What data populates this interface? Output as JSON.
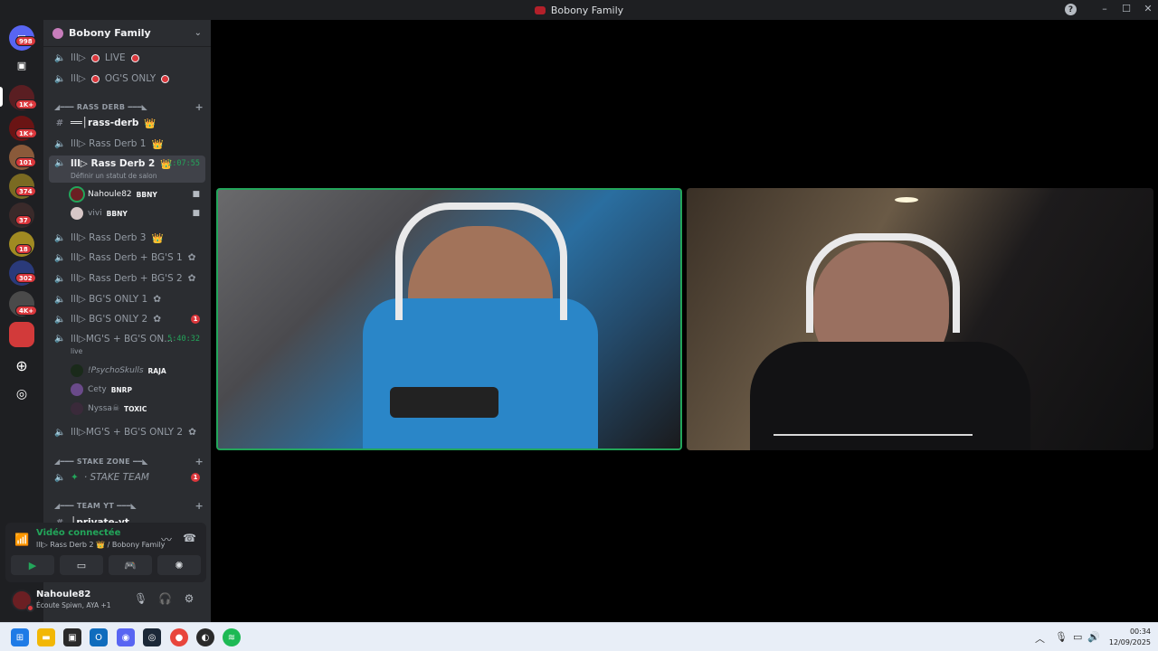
{
  "window": {
    "title": "Bobony Family",
    "help_icon": "?",
    "min": "–",
    "max": "☐",
    "close": "✕"
  },
  "rail": {
    "badges": [
      "998",
      "1K+",
      "1K+",
      "101",
      "374",
      "37",
      "18",
      "302",
      "4K+"
    ]
  },
  "server": {
    "name": "Bobony Family"
  },
  "channels": [
    {
      "label": "lll▷",
      "suffix": "LIVE"
    },
    {
      "label": "lll▷",
      "suffix": "OG'S ONLY"
    }
  ],
  "categories": {
    "rass_derb": "◢━━━ RASS DERB ━━━◣",
    "stake_zone": "◢━━━ STAKE ZONE ━━◣",
    "team_yt": "◢━━━ TEAM YT ━━━◣"
  },
  "rass_channels": {
    "text": "══│rass-derb",
    "derb1": "lll▷ Rass Derb 1",
    "derb2": "lll▷ Rass Derb 2",
    "derb2_timer": "1:07:55",
    "derb2_sub": "Définir un statut de salon",
    "derb3": "lll▷ Rass Derb 3",
    "bg1": "lll▷ Rass Derb + BG'S 1",
    "bg2": "lll▷ Rass Derb + BG'S 2",
    "bgonly1": "lll▷ BG'S ONLY 1",
    "bgonly2": "lll▷ BG'S ONLY 2",
    "bgonly2_alert": "1",
    "mgs": "lll▷MG'S + BG'S ON...",
    "mgs_timer": "5:40:32",
    "mgs_sub": "live",
    "mgs2": "lll▷MG'S + BG'S ONLY 2"
  },
  "users_derb2": [
    {
      "name": "Nahoule82",
      "tag": "BBNY"
    },
    {
      "name": "vivi",
      "tag": "BBNY"
    }
  ],
  "users_mgs": [
    {
      "name": "!PsychoSkulls",
      "tag": "RAJA"
    },
    {
      "name": "Cety",
      "tag": "BNRP"
    },
    {
      "name": "Nyssa☠",
      "tag": "TOXIC"
    }
  ],
  "stake": {
    "channel": "· STAKE TEAM",
    "alert": "1"
  },
  "team_yt": {
    "channel": "│private-yt"
  },
  "voice": {
    "title": "Vidéo connectée",
    "sub": "lll▷ Rass Derb 2 👑 / Bobony Family"
  },
  "user_panel": {
    "name": "Nahoule82",
    "activity": "Écoute Spiwn, AYA +1"
  },
  "clock": {
    "time": "00:34",
    "date": "12/09/2025"
  },
  "colors": {
    "accent_green": "#23a55a",
    "danger": "#da373c",
    "sidebar": "#2b2d31",
    "rail": "#1e1f22"
  }
}
